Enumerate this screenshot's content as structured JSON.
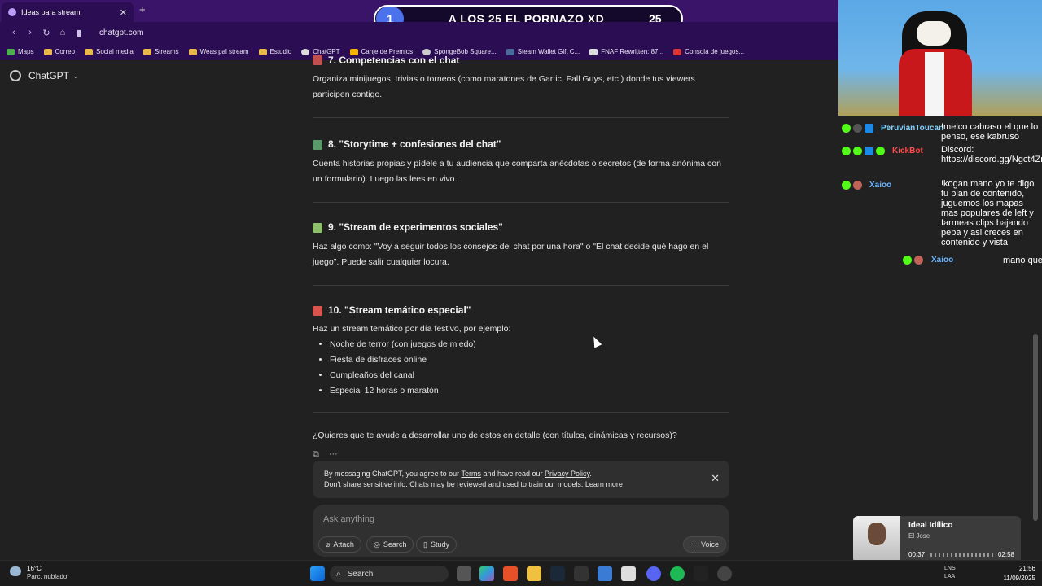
{
  "browser": {
    "tab_title": "Ideas para stream",
    "new_tab": "+",
    "url": "chatgpt.com",
    "bookmarks": [
      "Maps",
      "Correo",
      "Social media",
      "Streams",
      "Weas pal stream",
      "Estudio",
      "ChatGPT",
      "Canje de Premios",
      "SpongeBob Square...",
      "Steam Wallet Gift C...",
      "FNAF Rewritten: 87...",
      "Consola de juegos..."
    ]
  },
  "banner": {
    "badge": "1",
    "text": "A LOS 25 EL PORNAZO XD",
    "count": "25"
  },
  "app": {
    "title": "ChatGPT"
  },
  "content": {
    "s7_title": "7. Competencias con el chat",
    "s7_body": "Organiza minijuegos, trivias o torneos (como maratones de Gartic, Fall Guys, etc.) donde tus viewers participen contigo.",
    "s8_title": "8. \"Storytime + confesiones del chat\"",
    "s8_body": "Cuenta historias propias y pídele a tu audiencia que comparta anécdotas o secretos (de forma anónima con un formulario). Luego las lees en vivo.",
    "s9_title": "9. \"Stream de experimentos sociales\"",
    "s9_body": "Haz algo como: \"Voy a seguir todos los consejos del chat por una hora\" o \"El chat decide qué hago en el juego\". Puede salir cualquier locura.",
    "s10_title": "10. \"Stream temático especial\"",
    "s10_intro": "Haz un stream temático por día festivo, por ejemplo:",
    "s10_items": [
      "Noche de terror (con juegos de miedo)",
      "Fiesta de disfraces online",
      "Cumpleaños del canal",
      "Especial 12 horas o maratón"
    ],
    "question": "¿Quieres que te ayude a desarrollar uno de estos en detalle (con títulos, dinámicas y recursos)?"
  },
  "notice": {
    "line1_a": "By messaging ChatGPT, you agree to our ",
    "terms": "Terms",
    "line1_b": " and have read our ",
    "privacy": "Privacy Policy",
    "line1_c": ".",
    "line2_a": "Don't share sensitive info. Chats may be reviewed and used to train our models. ",
    "learn": "Learn more"
  },
  "composer": {
    "placeholder": "Ask anything",
    "attach": "Attach",
    "search": "Search",
    "study": "Study",
    "voice": "Voice"
  },
  "stream_chat": [
    {
      "user": "PeruvianToucan",
      "color": "#7fd3ff",
      "msg": "!melco cabraso el que lo penso, ese kabruso"
    },
    {
      "user": "KickBot",
      "color": "#ff4b4b",
      "msg": "Discord: https://discord.gg/Ngct4ZrsVw"
    },
    {
      "user": "Xaioo",
      "color": "#6ab4ff",
      "msg": "!kogan mano yo te digo tu plan de contenido, juguemos los mapas mas populares de left y farmeas clips bajando pepa y asi creces en contenido y vista"
    },
    {
      "user": "Xaioo",
      "color": "#6ab4ff",
      "msg": "mano que"
    }
  ],
  "music": {
    "title": "Ideal Idílico",
    "artist": "El Jose",
    "elapsed": "00:37",
    "total": "02:58"
  },
  "taskbar": {
    "temp": "16°C",
    "cond": "Parc. nublado",
    "search": "Search",
    "lang1": "LNS",
    "lang2": "LAA",
    "time": "21:56",
    "date": "11/09/2025"
  }
}
